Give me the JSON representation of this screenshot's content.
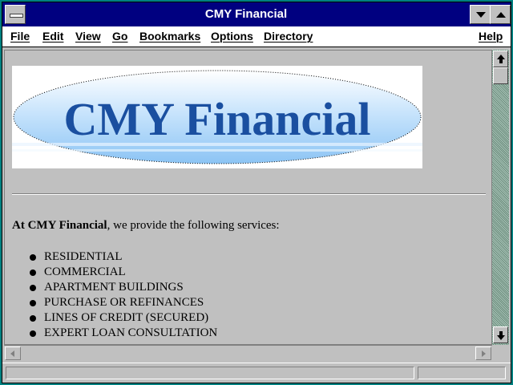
{
  "window": {
    "title": "CMY Financial"
  },
  "menubar": {
    "items": [
      "File",
      "Edit",
      "View",
      "Go",
      "Bookmarks",
      "Options",
      "Directory"
    ],
    "help": "Help"
  },
  "content": {
    "logo_text": "CMY Financial",
    "intro_bold": "At CMY Financial",
    "intro_rest": ", we provide the following services:",
    "services": [
      "RESIDENTIAL",
      "COMMERCIAL",
      "APARTMENT BUILDINGS",
      "PURCHASE OR REFINANCES",
      "LINES OF CREDIT (SECURED)",
      "EXPERT LOAN CONSULTATION"
    ]
  },
  "colors": {
    "titlebar": "#000080",
    "desktop": "#008080",
    "logo_text": "#1a4fa0",
    "logo_ellipse": "#a8d0f8"
  },
  "status": {
    "text": ""
  }
}
